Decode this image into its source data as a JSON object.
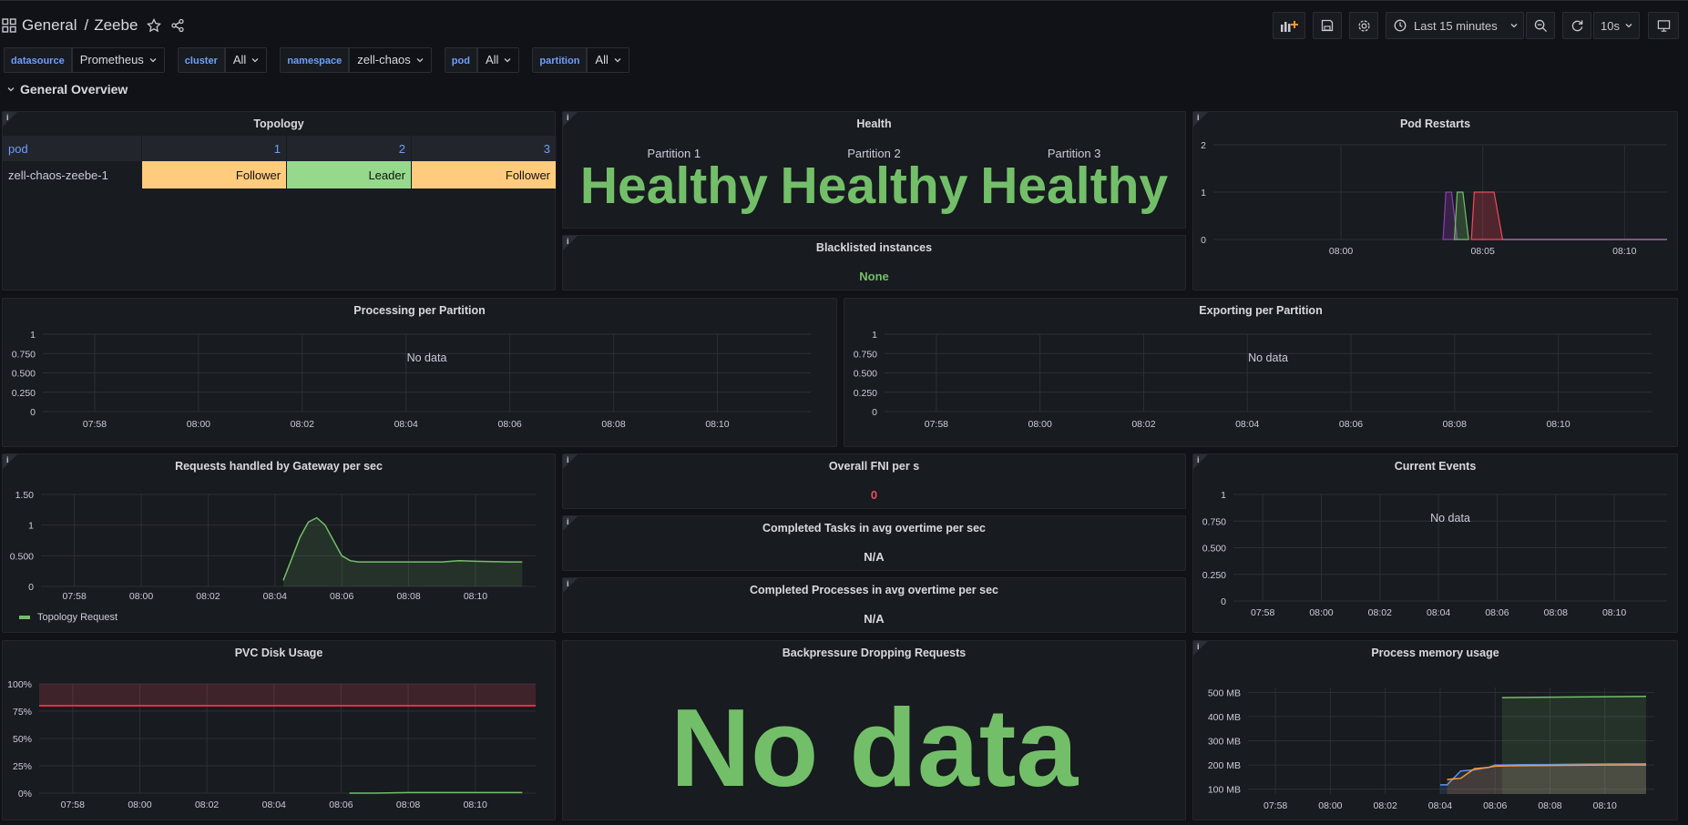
{
  "header": {
    "folder": "General",
    "separator": "/",
    "dashboard": "Zeebe"
  },
  "toolbar": {
    "time_range": "Last 15 minutes",
    "refresh": "10s"
  },
  "variables": [
    {
      "label": "datasource",
      "value": "Prometheus"
    },
    {
      "label": "cluster",
      "value": "All"
    },
    {
      "label": "namespace",
      "value": "zell-chaos"
    },
    {
      "label": "pod",
      "value": "All"
    },
    {
      "label": "partition",
      "value": "All"
    }
  ],
  "row": {
    "title": "General Overview"
  },
  "colors": {
    "green": "#73bf69",
    "orange": "#ffcb7d",
    "red": "#f2495c",
    "blue": "#6e9fff",
    "bg": "#111217",
    "panel": "#181b1f"
  },
  "topology": {
    "title": "Topology",
    "columns": [
      "pod",
      "1",
      "2",
      "3"
    ],
    "rows": [
      {
        "pod": "zell-chaos-zeebe-1",
        "cells": [
          "Follower",
          "Leader",
          "Follower"
        ]
      }
    ]
  },
  "health": {
    "title": "Health",
    "partitions": [
      {
        "label": "Partition 1",
        "value": "Healthy"
      },
      {
        "label": "Partition 2",
        "value": "Healthy"
      },
      {
        "label": "Partition 3",
        "value": "Healthy"
      }
    ]
  },
  "blacklisted": {
    "title": "Blacklisted instances",
    "value": "None"
  },
  "fni": {
    "title": "Overall FNI per s",
    "value": "0"
  },
  "completed_tasks": {
    "title": "Completed Tasks in avg overtime per sec",
    "value": "N/A"
  },
  "completed_processes": {
    "title": "Completed Processes in avg overtime per sec",
    "value": "N/A"
  },
  "backpressure": {
    "title": "Backpressure Dropping Requests",
    "value": "No data"
  },
  "no_data_text": "No data",
  "chart_data": [
    {
      "id": "pod_restarts",
      "type": "area",
      "title": "Pod Restarts",
      "x_ticks": [
        "08:00",
        "08:05",
        "08:10"
      ],
      "y_ticks": [
        "0",
        "1",
        "2"
      ],
      "ylim": [
        0,
        2
      ],
      "x": [
        "07:58",
        "08:04",
        "08:04",
        "08:04",
        "08:04",
        "08:05",
        "08:05",
        "08:06",
        "08:11"
      ],
      "series": [
        {
          "color": "#8f3bb8",
          "values": [
            null,
            0,
            1,
            1,
            0,
            null,
            null,
            null,
            null
          ]
        },
        {
          "color": "#73bf69",
          "values": [
            null,
            null,
            null,
            1,
            1,
            0,
            null,
            null,
            null
          ]
        },
        {
          "color": "#f2495c",
          "values": [
            null,
            null,
            null,
            null,
            null,
            1,
            1,
            0,
            0
          ]
        }
      ]
    },
    {
      "id": "processing",
      "type": "line",
      "title": "Processing per Partition",
      "x_ticks": [
        "07:58",
        "08:00",
        "08:02",
        "08:04",
        "08:06",
        "08:08",
        "08:10"
      ],
      "y_ticks": [
        "0",
        "0.250",
        "0.500",
        "0.750",
        "1"
      ],
      "ylim": [
        0,
        1
      ],
      "series": [],
      "no_data": true
    },
    {
      "id": "exporting",
      "type": "line",
      "title": "Exporting per Partition",
      "x_ticks": [
        "07:58",
        "08:00",
        "08:02",
        "08:04",
        "08:06",
        "08:08",
        "08:10"
      ],
      "y_ticks": [
        "0",
        "0.250",
        "0.500",
        "0.750",
        "1"
      ],
      "ylim": [
        0,
        1
      ],
      "series": [],
      "no_data": true
    },
    {
      "id": "requests",
      "type": "area",
      "title": "Requests handled by Gateway per sec",
      "x_ticks": [
        "07:58",
        "08:00",
        "08:02",
        "08:04",
        "08:06",
        "08:08",
        "08:10"
      ],
      "y_ticks": [
        "0",
        "0.500",
        "1",
        "1.50"
      ],
      "ylim": [
        0,
        1.5
      ],
      "x_minutes": [
        4.25,
        4.5,
        4.75,
        5.0,
        5.25,
        5.5,
        5.75,
        6.0,
        6.25,
        6.5,
        7.0,
        8.0,
        9.0,
        9.5,
        10.0,
        11.0,
        11.4
      ],
      "series": [
        {
          "name": "Topology Request",
          "color": "#73bf69",
          "values": [
            0.1,
            0.45,
            0.8,
            1.05,
            1.12,
            1.0,
            0.75,
            0.5,
            0.42,
            0.4,
            0.4,
            0.4,
            0.4,
            0.42,
            0.41,
            0.4,
            0.4
          ]
        }
      ]
    },
    {
      "id": "current_events",
      "type": "line",
      "title": "Current Events",
      "x_ticks": [
        "07:58",
        "08:00",
        "08:02",
        "08:04",
        "08:06",
        "08:08",
        "08:10"
      ],
      "y_ticks": [
        "0",
        "0.250",
        "0.500",
        "0.750",
        "1"
      ],
      "ylim": [
        0,
        1
      ],
      "series": [],
      "no_data": true
    },
    {
      "id": "pvc",
      "type": "line",
      "title": "PVC Disk Usage",
      "x_ticks": [
        "07:58",
        "08:00",
        "08:02",
        "08:04",
        "08:06",
        "08:08",
        "08:10"
      ],
      "y_ticks": [
        "0%",
        "25%",
        "50%",
        "75%",
        "100%"
      ],
      "ylim": [
        0,
        100
      ],
      "threshold": 80,
      "x_minutes": [
        6.25,
        7.0,
        8.0,
        9.0,
        10.0,
        11.4
      ],
      "series": [
        {
          "color": "#73bf69",
          "values": [
            0,
            0,
            0.5,
            0.5,
            0.5,
            0.5
          ]
        }
      ]
    },
    {
      "id": "memory",
      "type": "area",
      "title": "Process memory usage",
      "x_ticks": [
        "07:58",
        "08:00",
        "08:02",
        "08:04",
        "08:06",
        "08:08",
        "08:10"
      ],
      "y_ticks": [
        "100 MB",
        "200 MB",
        "300 MB",
        "400 MB",
        "500 MB"
      ],
      "ylim": [
        80,
        520
      ],
      "x_minutes": [
        4.0,
        4.25,
        4.75,
        5.25,
        5.75,
        6.0,
        6.25,
        7.0,
        8.0,
        9.0,
        10.0,
        11.5
      ],
      "series": [
        {
          "color": "#73bf69",
          "values": [
            null,
            null,
            null,
            null,
            null,
            null,
            478,
            479,
            480,
            481,
            482,
            483
          ]
        },
        {
          "color": "#5794f2",
          "values": [
            118,
            118,
            175,
            180,
            190,
            200,
            200,
            201,
            202,
            203,
            204,
            205
          ]
        },
        {
          "color": "#ff9830",
          "values": [
            null,
            140,
            145,
            185,
            190,
            195,
            196,
            197,
            198,
            199,
            200,
            200
          ]
        }
      ]
    }
  ]
}
